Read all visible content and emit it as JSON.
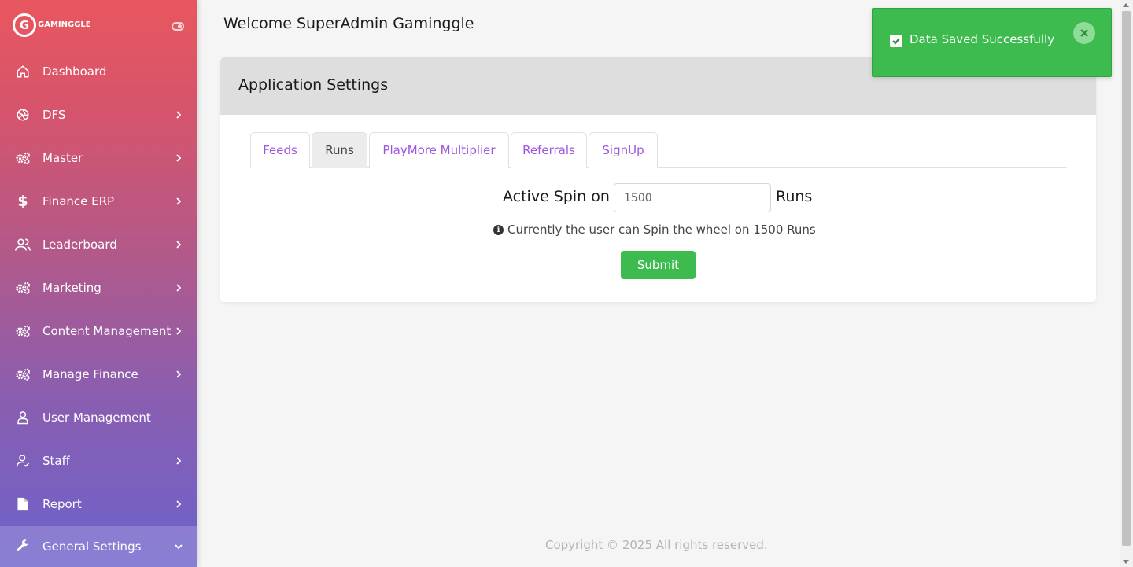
{
  "brand": {
    "logo_letter": "G",
    "logo_text": "GAMINGGLE"
  },
  "sidebar": {
    "items": [
      {
        "label": "Dashboard",
        "icon": "home-icon",
        "has_chevron": false
      },
      {
        "label": "DFS",
        "icon": "aperture-icon",
        "has_chevron": true
      },
      {
        "label": "Master",
        "icon": "gears-icon",
        "has_chevron": true
      },
      {
        "label": "Finance ERP",
        "icon": "dollar-icon",
        "has_chevron": true
      },
      {
        "label": "Leaderboard",
        "icon": "users-icon",
        "has_chevron": true
      },
      {
        "label": "Marketing",
        "icon": "gears-icon",
        "has_chevron": true
      },
      {
        "label": "Content Management",
        "icon": "gears-icon",
        "has_chevron": true
      },
      {
        "label": "Manage Finance",
        "icon": "gears-icon",
        "has_chevron": true
      },
      {
        "label": "User Management",
        "icon": "user-icon",
        "has_chevron": false
      },
      {
        "label": "Staff",
        "icon": "staff-icon",
        "has_chevron": true
      },
      {
        "label": "Report",
        "icon": "file-icon",
        "has_chevron": true
      },
      {
        "label": "General Settings",
        "icon": "wrench-icon",
        "has_chevron": true,
        "expanded": true,
        "active": true
      }
    ]
  },
  "header": {
    "welcome": "Welcome SuperAdmin Gaminggle"
  },
  "card": {
    "title": "Application Settings",
    "tabs": [
      {
        "label": "Feeds",
        "active": false
      },
      {
        "label": "Runs",
        "active": true
      },
      {
        "label": "PlayMore Multiplier",
        "active": false
      },
      {
        "label": "Referrals",
        "active": false
      },
      {
        "label": "SignUp",
        "active": false
      }
    ],
    "spin_label": "Active Spin on",
    "spin_value": "1500",
    "spin_unit": "Runs",
    "info_text": "Currently the user can Spin the wheel on 1500 Runs",
    "submit_label": "Submit"
  },
  "toast": {
    "message": "Data Saved Successfully"
  },
  "footer": {
    "copyright": "Copyright © 2025  All rights reserved."
  },
  "colors": {
    "accent_purple": "#9b55e0",
    "success_green": "#3dbb4e",
    "sidebar_top": "#e8575f",
    "sidebar_bottom": "#6d62cc"
  }
}
